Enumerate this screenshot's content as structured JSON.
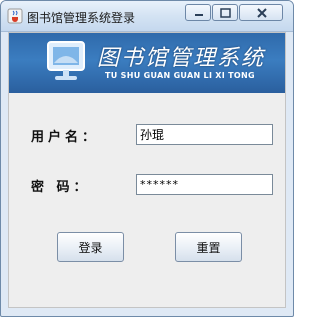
{
  "window": {
    "title": "图书馆管理系统登录"
  },
  "banner": {
    "title": "图书馆管理系统",
    "subtitle": "TU SHU GUAN GUAN LI XI TONG"
  },
  "form": {
    "username_label": "用户名：",
    "username_value": "孙琨",
    "password_label": "密  码：",
    "password_value": "******"
  },
  "buttons": {
    "login": "登录",
    "reset": "重置"
  },
  "icons": {
    "app": "java-cup-icon",
    "minimize": "minimize-icon",
    "maximize": "maximize-icon",
    "close": "close-icon",
    "logo": "computer-monitor-icon"
  },
  "colors": {
    "banner": "#3b7dc0",
    "client_bg": "#eeeeee"
  }
}
